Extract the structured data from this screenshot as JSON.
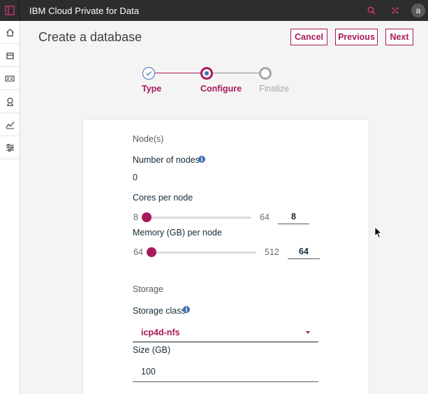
{
  "app": {
    "title": "IBM Cloud Private for Data",
    "avatar_letter": "a",
    "accent_color": "#a8195a",
    "header_icons": [
      "search-icon",
      "apps-grid-icon"
    ]
  },
  "sidebar": {
    "items": [
      {
        "name": "home",
        "icon": "home-icon"
      },
      {
        "name": "collect",
        "icon": "archive-icon"
      },
      {
        "name": "organize",
        "icon": "catalog-icon"
      },
      {
        "name": "analyze",
        "icon": "ribbon-icon"
      },
      {
        "name": "monitor",
        "icon": "chart-icon"
      },
      {
        "name": "administer",
        "icon": "sliders-icon"
      }
    ]
  },
  "page": {
    "title": "Create a database",
    "buttons": {
      "cancel": "Cancel",
      "previous": "Previous",
      "next": "Next"
    }
  },
  "stepper": {
    "steps": [
      {
        "label": "Type",
        "state": "complete"
      },
      {
        "label": "Configure",
        "state": "current"
      },
      {
        "label": "Finalize",
        "state": "pending"
      }
    ]
  },
  "form": {
    "nodes_section": "Node(s)",
    "number_of_nodes": {
      "label": "Number of nodes",
      "value": "0"
    },
    "cores": {
      "label": "Cores per node",
      "min": "8",
      "max": "64",
      "value": "8"
    },
    "memory": {
      "label": "Memory (GB) per node",
      "min": "64",
      "max": "512",
      "value": "64"
    },
    "storage_section": "Storage",
    "storage_class": {
      "label": "Storage class",
      "value": "icp4d-nfs"
    },
    "size": {
      "label": "Size (GB)",
      "value": "100"
    }
  }
}
